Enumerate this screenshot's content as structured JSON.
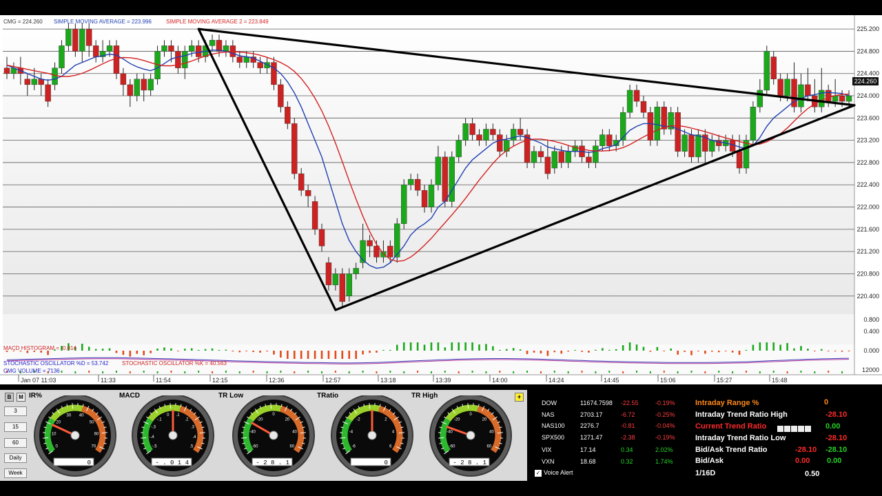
{
  "legend": {
    "price": "CMG = 224.260",
    "sma1": "SIMPLE MOVING AVERAGE = 223.996",
    "sma2": "SIMPLE MOVING AVERAGE 2 = 223.849",
    "macd": "MACD HISTOGRAM = -0.014",
    "stoch_k": "STOCHASTIC OSCILLATOR %D = 53.742",
    "stoch_d": "STOCHASTIC OSCILLATOR %K = 40.563",
    "volume": "CMG VOLUME = 7136"
  },
  "colors": {
    "up": "#1ba81b",
    "down": "#cc2222",
    "sma1": "#1f3fb0",
    "sma2": "#d42020",
    "trend": "#000000"
  },
  "chart_data": {
    "type": "line",
    "symbol": "CMG",
    "ylim": [
      220.1,
      225.35
    ],
    "y_ticks": [
      "225.200",
      "224.800",
      "224.400",
      "224.000",
      "223.600",
      "223.200",
      "222.800",
      "222.400",
      "222.000",
      "221.600",
      "221.200",
      "220.800",
      "220.400"
    ],
    "x_ticks": [
      "Jan 07 11:03",
      "11:33",
      "11:54",
      "12:15",
      "12:36",
      "12:57",
      "13:18",
      "13:39",
      "14:00",
      "14:24",
      "14:45",
      "15:06",
      "15:27",
      "15:48"
    ],
    "last_price": "224.260",
    "candles": [
      [
        224.5,
        224.4,
        224.7,
        224.3
      ],
      [
        224.4,
        224.5,
        224.6,
        224.3
      ],
      [
        224.5,
        224.4,
        224.7,
        224.2
      ],
      [
        224.3,
        224.2,
        224.4,
        224.0
      ],
      [
        224.2,
        224.3,
        224.5,
        224.1
      ],
      [
        224.3,
        224.2,
        224.4,
        224.0
      ],
      [
        224.2,
        223.9,
        224.3,
        223.8
      ],
      [
        224.2,
        224.5,
        224.6,
        224.1
      ],
      [
        224.5,
        224.9,
        225.0,
        224.4
      ],
      [
        224.9,
        225.2,
        225.3,
        224.8
      ],
      [
        225.2,
        224.8,
        225.3,
        224.7
      ],
      [
        224.8,
        225.2,
        225.3,
        224.6
      ],
      [
        225.2,
        224.9,
        225.3,
        224.7
      ],
      [
        224.9,
        224.7,
        225.0,
        224.6
      ],
      [
        224.7,
        224.8,
        225.0,
        224.6
      ],
      [
        224.8,
        224.9,
        225.0,
        224.7
      ],
      [
        224.9,
        224.4,
        225.0,
        224.3
      ],
      [
        224.4,
        224.2,
        224.5,
        224.0
      ],
      [
        224.2,
        224.0,
        224.3,
        223.8
      ],
      [
        224.0,
        224.3,
        224.4,
        223.9
      ],
      [
        224.3,
        224.1,
        224.4,
        223.9
      ],
      [
        224.1,
        224.3,
        224.4,
        224.0
      ],
      [
        224.3,
        224.8,
        224.9,
        224.2
      ],
      [
        224.8,
        224.9,
        225.0,
        224.7
      ],
      [
        224.9,
        224.8,
        225.0,
        224.6
      ],
      [
        224.8,
        224.5,
        224.9,
        224.4
      ],
      [
        224.5,
        224.8,
        224.9,
        224.3
      ],
      [
        224.8,
        224.9,
        225.0,
        224.7
      ],
      [
        224.9,
        224.7,
        225.0,
        224.6
      ],
      [
        224.7,
        224.9,
        225.0,
        224.6
      ],
      [
        224.9,
        225.0,
        225.1,
        224.8
      ],
      [
        225.0,
        224.8,
        225.1,
        224.7
      ],
      [
        224.8,
        224.9,
        225.0,
        224.7
      ],
      [
        224.9,
        224.7,
        225.0,
        224.6
      ],
      [
        224.7,
        224.6,
        224.8,
        224.5
      ],
      [
        224.6,
        224.7,
        224.8,
        224.5
      ],
      [
        224.7,
        224.6,
        224.8,
        224.5
      ],
      [
        224.6,
        224.5,
        224.7,
        224.4
      ],
      [
        224.5,
        224.6,
        224.7,
        224.4
      ],
      [
        224.6,
        224.2,
        224.7,
        224.1
      ],
      [
        224.2,
        223.8,
        224.3,
        223.7
      ],
      [
        223.8,
        223.5,
        223.9,
        223.4
      ],
      [
        223.5,
        222.6,
        223.6,
        222.5
      ],
      [
        222.6,
        222.3,
        222.7,
        222.2
      ],
      [
        222.3,
        222.2,
        222.4,
        222.0
      ],
      [
        222.1,
        221.6,
        222.2,
        221.5
      ],
      [
        221.6,
        221.3,
        221.7,
        221.2
      ],
      [
        221.0,
        220.6,
        221.1,
        220.5
      ],
      [
        220.6,
        220.8,
        220.9,
        220.5
      ],
      [
        220.8,
        220.3,
        220.9,
        220.2
      ],
      [
        220.4,
        220.8,
        220.9,
        220.3
      ],
      [
        220.8,
        220.9,
        221.0,
        220.7
      ],
      [
        221.0,
        221.4,
        221.7,
        220.9
      ],
      [
        221.4,
        221.3,
        221.5,
        221.1
      ],
      [
        221.3,
        221.1,
        221.4,
        221.0
      ],
      [
        221.1,
        221.2,
        221.4,
        221.0
      ],
      [
        221.3,
        221.1,
        221.4,
        221.0
      ],
      [
        221.1,
        221.7,
        221.8,
        221.0
      ],
      [
        221.7,
        222.4,
        222.5,
        221.6
      ],
      [
        222.4,
        222.5,
        222.6,
        222.3
      ],
      [
        222.5,
        222.3,
        222.6,
        222.2
      ],
      [
        222.3,
        222.0,
        222.4,
        221.9
      ],
      [
        222.0,
        222.4,
        222.5,
        221.9
      ],
      [
        222.4,
        222.9,
        223.1,
        222.3
      ],
      [
        222.9,
        222.1,
        223.0,
        222.0
      ],
      [
        222.1,
        222.9,
        223.0,
        222.0
      ],
      [
        222.9,
        223.2,
        223.3,
        222.8
      ],
      [
        223.2,
        223.5,
        223.6,
        223.1
      ],
      [
        223.5,
        223.3,
        223.6,
        223.2
      ],
      [
        223.3,
        223.2,
        223.4,
        223.1
      ],
      [
        223.2,
        223.4,
        223.5,
        223.1
      ],
      [
        223.4,
        223.3,
        223.5,
        223.2
      ],
      [
        223.3,
        223.0,
        223.4,
        222.9
      ],
      [
        223.0,
        223.2,
        223.3,
        222.9
      ],
      [
        223.2,
        223.4,
        223.5,
        223.1
      ],
      [
        223.4,
        223.3,
        223.6,
        223.2
      ],
      [
        223.3,
        222.8,
        223.4,
        222.7
      ],
      [
        222.8,
        223.0,
        223.1,
        222.7
      ],
      [
        223.0,
        222.9,
        223.1,
        222.8
      ],
      [
        222.9,
        222.6,
        223.2,
        222.5
      ],
      [
        222.7,
        223.0,
        223.1,
        222.6
      ],
      [
        223.0,
        222.8,
        223.1,
        222.7
      ],
      [
        222.8,
        223.0,
        223.1,
        222.7
      ],
      [
        223.0,
        223.1,
        223.2,
        222.9
      ],
      [
        223.1,
        222.9,
        223.2,
        222.8
      ],
      [
        222.9,
        222.8,
        223.0,
        222.7
      ],
      [
        222.8,
        223.1,
        223.2,
        222.7
      ],
      [
        223.1,
        223.3,
        223.4,
        223.0
      ],
      [
        223.3,
        223.1,
        223.4,
        223.0
      ],
      [
        223.1,
        223.2,
        223.3,
        223.0
      ],
      [
        223.2,
        223.7,
        223.8,
        223.1
      ],
      [
        223.7,
        224.1,
        224.2,
        223.6
      ],
      [
        224.1,
        223.9,
        224.2,
        223.8
      ],
      [
        223.9,
        223.7,
        224.0,
        223.6
      ],
      [
        223.7,
        223.2,
        223.8,
        223.1
      ],
      [
        223.2,
        223.8,
        223.9,
        223.1
      ],
      [
        223.8,
        223.4,
        223.9,
        223.3
      ],
      [
        223.4,
        223.7,
        223.8,
        223.3
      ],
      [
        223.7,
        223.0,
        223.8,
        222.9
      ],
      [
        223.0,
        223.3,
        223.4,
        222.9
      ],
      [
        223.3,
        222.9,
        223.4,
        222.8
      ],
      [
        222.9,
        223.3,
        223.4,
        222.8
      ],
      [
        223.3,
        223.0,
        223.4,
        222.8
      ],
      [
        223.0,
        223.2,
        223.3,
        222.9
      ],
      [
        223.2,
        223.1,
        223.3,
        223.0
      ],
      [
        223.1,
        223.2,
        223.3,
        223.0
      ],
      [
        223.2,
        223.0,
        223.3,
        222.9
      ],
      [
        223.0,
        222.7,
        223.3,
        222.6
      ],
      [
        222.7,
        223.2,
        223.3,
        222.6
      ],
      [
        223.2,
        223.8,
        223.9,
        223.1
      ],
      [
        223.8,
        224.1,
        224.3,
        223.7
      ],
      [
        224.1,
        224.8,
        224.9,
        224.0
      ],
      [
        224.7,
        224.3,
        224.8,
        224.2
      ],
      [
        224.3,
        224.0,
        224.4,
        223.9
      ],
      [
        224.0,
        224.3,
        224.4,
        223.9
      ],
      [
        224.3,
        223.8,
        224.6,
        223.7
      ],
      [
        223.8,
        224.2,
        224.4,
        223.7
      ],
      [
        224.2,
        224.0,
        224.5,
        223.9
      ],
      [
        224.0,
        223.8,
        224.3,
        223.7
      ],
      [
        223.8,
        224.1,
        224.5,
        223.7
      ],
      [
        224.1,
        223.9,
        224.2,
        223.8
      ],
      [
        223.9,
        224.0,
        224.3,
        223.8
      ],
      [
        224.0,
        223.9,
        224.1,
        223.8
      ],
      [
        223.9,
        224.0,
        224.1,
        223.8
      ]
    ],
    "sma1": [
      224.55,
      224.5,
      224.45,
      224.4,
      224.35,
      224.3,
      224.28,
      224.3,
      224.35,
      224.45,
      224.55,
      224.6,
      224.65,
      224.7,
      224.72,
      224.75,
      224.73,
      224.66,
      224.58,
      224.52,
      224.48,
      224.45,
      224.5,
      224.58,
      224.66,
      224.7,
      224.72,
      224.76,
      224.78,
      224.8,
      224.82,
      224.82,
      224.8,
      224.76,
      224.72,
      224.7,
      224.68,
      224.62,
      224.56,
      224.5,
      224.4,
      224.25,
      224.05,
      223.8,
      223.5,
      223.2,
      222.9,
      222.5,
      222.1,
      221.7,
      221.4,
      221.2,
      221.05,
      220.95,
      220.9,
      220.92,
      221.0,
      221.15,
      221.3,
      221.5,
      221.62,
      221.7,
      221.8,
      222.0,
      222.1,
      222.3,
      222.5,
      222.7,
      222.85,
      222.95,
      223.05,
      223.15,
      223.2,
      223.22,
      223.25,
      223.28,
      223.25,
      223.2,
      223.15,
      223.08,
      223.05,
      223.02,
      223.0,
      223.0,
      223.0,
      222.98,
      223.0,
      223.05,
      223.08,
      223.12,
      223.25,
      223.38,
      223.45,
      223.5,
      223.5,
      223.48,
      223.45,
      223.45,
      223.4,
      223.35,
      223.3,
      223.28,
      223.25,
      223.2,
      223.17,
      223.15,
      223.12,
      223.08,
      223.05,
      223.1,
      223.25,
      223.45,
      223.6,
      223.7,
      223.8,
      223.9,
      223.95,
      224.0,
      224.02,
      224.05,
      224.06,
      224.05,
      224.04,
      224.0
    ]
  },
  "macd_axis": "0.000",
  "volume_axis": "12000",
  "price_axis_extra": [
    "0.800",
    "0.400"
  ],
  "panel": {
    "toggles": [
      "B",
      "M"
    ],
    "period_buttons": [
      "3",
      "15",
      "60",
      "Daily",
      "Week"
    ],
    "gauges": [
      {
        "title": "IR%",
        "readout": "0"
      },
      {
        "title": "MACD",
        "readout": "- . 0 1 4"
      },
      {
        "title": "TR Low",
        "readout": "- 2 8 . 1"
      },
      {
        "title": "TRatio",
        "readout": "0"
      },
      {
        "title": "TR High",
        "readout": "- 2 8 . 1"
      }
    ],
    "plus_label": "+"
  },
  "market": [
    {
      "sym": "DOW",
      "last": "11674.7598",
      "chg": "-22.55",
      "pct": "-0.19%"
    },
    {
      "sym": "NAS",
      "last": "2703.17",
      "chg": "-6.72",
      "pct": "-0.25%"
    },
    {
      "sym": "NAS100",
      "last": "2276.7",
      "chg": "-0.81",
      "pct": "-0.04%"
    },
    {
      "sym": "SPX500",
      "last": "1271.47",
      "chg": "-2.38",
      "pct": "-0.19%"
    },
    {
      "sym": "VIX",
      "last": "17.14",
      "chg": "0.34",
      "pct": "2.02%"
    },
    {
      "sym": "VXN",
      "last": "18.68",
      "chg": "0.32",
      "pct": "1.74%"
    }
  ],
  "signals": {
    "range_label": "Intraday Range %",
    "range_val": "0",
    "high_label": "Intraday Trend Ratio High",
    "high_val": "-28.10",
    "current_label": "Current Trend Ratio",
    "current_val": "0.00",
    "low_label": "Intraday Trend Ratio Low",
    "low_val": "-28.10",
    "bidask_trend_label": "Bid/Ask Trend Ratio",
    "bidask_trend_a": "-28.10",
    "bidask_trend_b": "-28.10",
    "bidask_label": "Bid/Ask",
    "bidask_a": "0.00",
    "bidask_b": "0.00",
    "frac_label": "1/16D",
    "frac_val": "0.50"
  },
  "voice_alert": "Voice Alert"
}
